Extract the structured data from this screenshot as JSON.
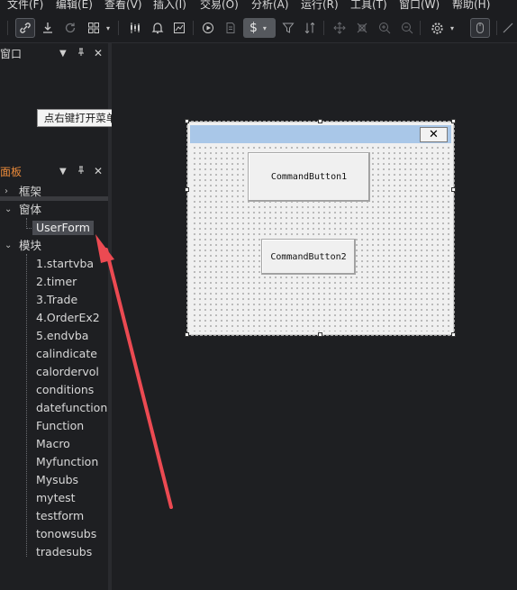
{
  "menubar": {
    "items": [
      "文件(F)",
      "编辑(E)",
      "查看(V)",
      "插入(I)",
      "交易(O)",
      "分析(A)",
      "运行(R)",
      "工具(T)",
      "窗口(W)",
      "帮助(H)"
    ]
  },
  "toolbar": {
    "currency_label": "$"
  },
  "window_panel": {
    "title": "窗口"
  },
  "tooltip": {
    "text": "点右键打开菜单"
  },
  "project_panel": {
    "title": "面板",
    "tree": {
      "frameworks_label": "框架",
      "forms_label": "窗体",
      "selected_form": "UserForm",
      "modules_label": "模块",
      "modules": [
        "1.startvba",
        "2.timer",
        "3.Trade",
        "4.OrderEx2",
        "5.endvba",
        "calindicate",
        "calordervol",
        "conditions",
        "datefunction",
        "Function",
        "Macro",
        "Myfunction",
        "Mysubs",
        "mytest",
        "testform",
        "tonowsubs",
        "tradesubs"
      ]
    }
  },
  "userform": {
    "close_glyph": "✕",
    "button1_caption": "CommandButton1",
    "button2_caption": "CommandButton2"
  },
  "colors": {
    "background": "#1e1f22",
    "panel_title_accent": "#e8893a",
    "arrow": "#ec4a52",
    "form_titlebar": "#a9c7e8"
  }
}
